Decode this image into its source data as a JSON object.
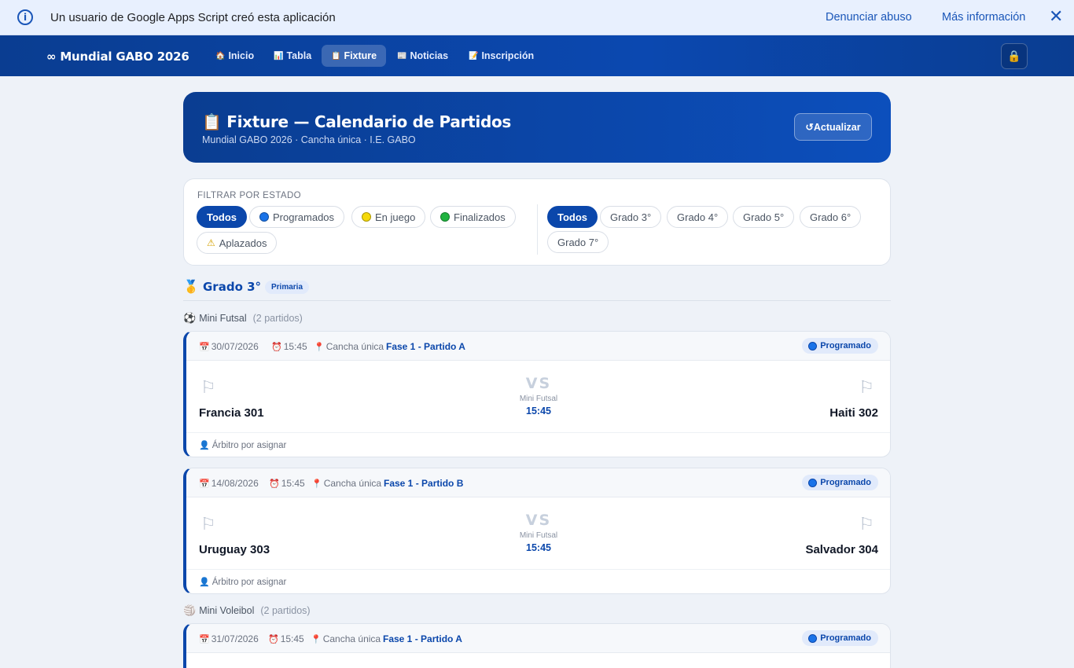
{
  "banner": {
    "message": "Un usuario de Google Apps Script creó esta aplicación",
    "report_link": "Denunciar abuso",
    "more_info_link": "Más información",
    "info_icon": "info-icon",
    "close_icon": "close-icon"
  },
  "navbar": {
    "brand": "∞ Mundial GABO 2026",
    "items": [
      {
        "icon": "🏠",
        "label": "Inicio",
        "active": false
      },
      {
        "icon": "📊",
        "label": "Tabla",
        "active": false
      },
      {
        "icon": "📋",
        "label": "Fixture",
        "active": true
      },
      {
        "icon": "📰",
        "label": "Noticias",
        "active": false
      },
      {
        "icon": "📝",
        "label": "Inscripción",
        "active": false
      }
    ],
    "lock_icon": "lock-icon"
  },
  "hero": {
    "title": "📋 Fixture — Calendario de Partidos",
    "subtitle": "Mundial GABO 2026 · Cancha única · I.E. GABO",
    "refresh_label": "↺Actualizar"
  },
  "filters": {
    "label": "FILTRAR POR ESTADO",
    "status": [
      {
        "label": "Todos",
        "active": true
      },
      {
        "label": "Programados",
        "dot": "#1a73e8"
      },
      {
        "label": "En juego",
        "dot": "#f5d90a"
      },
      {
        "label": "Finalizados",
        "dot": "#1fb33f"
      },
      {
        "label": "Aplazados",
        "warn": true
      }
    ],
    "grades": [
      {
        "label": "Todos",
        "active": true
      },
      {
        "label": "Grado 3°"
      },
      {
        "label": "Grado 4°"
      },
      {
        "label": "Grado 5°"
      },
      {
        "label": "Grado 6°"
      },
      {
        "label": "Grado 7°"
      }
    ]
  },
  "grade_section": {
    "medal_icon": "🥇",
    "title": "Grado 3°",
    "level": "Primaria"
  },
  "sports": [
    {
      "icon": "⚽",
      "name": "Mini Futsal",
      "count": "(2 partidos)"
    },
    {
      "icon": "🏐",
      "name": "Mini Voleibol",
      "count": "(2 partidos)"
    }
  ],
  "matches": [
    {
      "date": "30/07/2026",
      "time": "15:45",
      "venue": "Cancha única",
      "phase": "Fase 1 - Partido A",
      "status": "Programado",
      "home": "Francia 301",
      "away": "Haiti 302",
      "vs": "VS",
      "sport": "Mini Futsal",
      "center_time": "15:45",
      "referee": "Árbitro por asignar"
    },
    {
      "date": "14/08/2026",
      "time": "15:45",
      "venue": "Cancha única",
      "phase": "Fase 1 - Partido B",
      "status": "Programado",
      "home": "Uruguay 303",
      "away": "Salvador 304",
      "vs": "VS",
      "sport": "Mini Futsal",
      "center_time": "15:45",
      "referee": "Árbitro por asignar"
    },
    {
      "date": "31/07/2026",
      "time": "15:45",
      "venue": "Cancha única",
      "phase": "Fase 1 - Partido A",
      "status": "Programado"
    }
  ],
  "icons": {
    "calendar": "📅",
    "clock": "⏰",
    "pin": "📍",
    "flag": "⚐",
    "referee": "👤"
  },
  "colors": {
    "primary": "#0b47ab",
    "navbar": "#0a3d91",
    "background": "#eef2f8",
    "scheduled_dot": "#1a73e8"
  }
}
